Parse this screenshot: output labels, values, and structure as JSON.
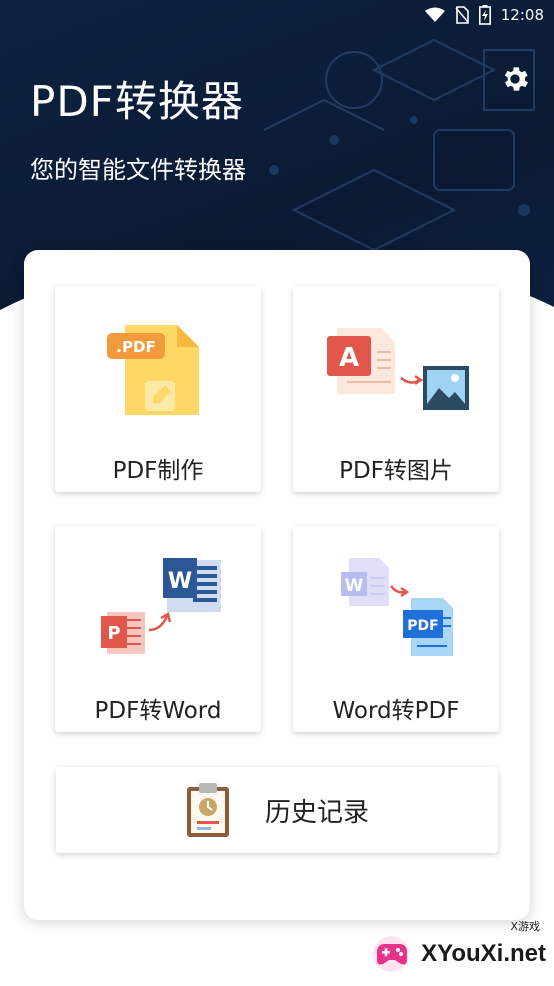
{
  "status_bar": {
    "time": "12:08"
  },
  "header": {
    "title": "PDF转换器",
    "subtitle": "您的智能文件转换器"
  },
  "tiles": [
    {
      "label": "PDF制作"
    },
    {
      "label": "PDF转图片"
    },
    {
      "label": "PDF转Word"
    },
    {
      "label": "Word转PDF"
    }
  ],
  "history": {
    "label": "历史记录"
  },
  "icons": {
    "settings": "gear-icon",
    "pdf_create": "pdf-document-icon",
    "pdf_to_image": "pdf-to-image-icon",
    "pdf_to_word": "pdf-to-word-icon",
    "word_to_pdf": "word-to-pdf-icon",
    "history": "clipboard-clock-icon"
  },
  "watermark": {
    "text": "XYouXi.net",
    "small": "X游戏"
  },
  "colors": {
    "header_bg": "#0d2240",
    "pdf_red": "#e2574c",
    "word_blue": "#2b5797",
    "folder_yellow": "#ffd766"
  }
}
